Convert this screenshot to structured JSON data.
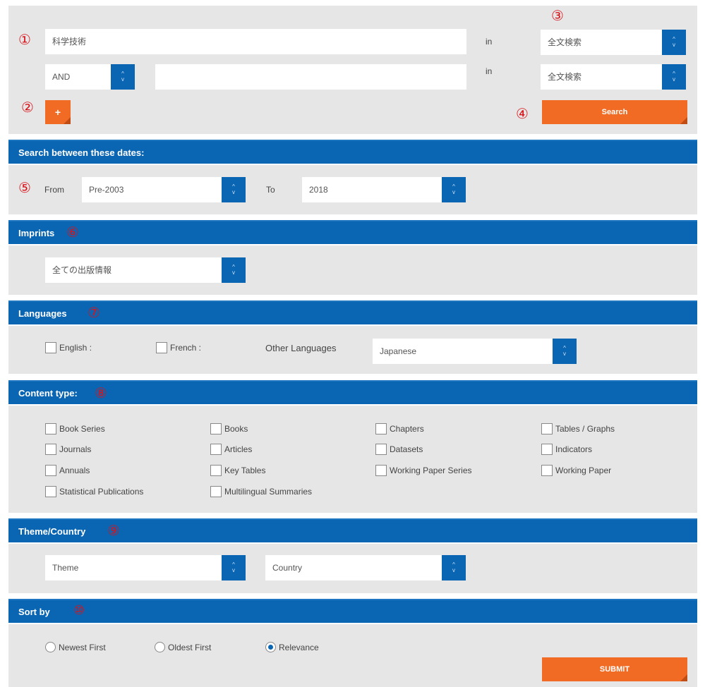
{
  "markers": [
    "①",
    "②",
    "③",
    "④",
    "⑤",
    "⑥",
    "⑦",
    "⑧",
    "⑨",
    "⑩"
  ],
  "search": {
    "query1": "科学技術",
    "in_label": "in",
    "scope1": "全文検索",
    "operator": "AND",
    "query2": "",
    "scope2": "全文検索",
    "add_label": "+",
    "search_label": "Search"
  },
  "dates": {
    "header": "Search between these dates:",
    "from_label": "From",
    "from_value": "Pre-2003",
    "to_label": "To",
    "to_value": "2018"
  },
  "imprints": {
    "header": "Imprints",
    "value": "全ての出版情報"
  },
  "languages": {
    "header": "Languages",
    "english": "English :",
    "french": "French :",
    "other_label": "Other Languages",
    "other_value": "Japanese"
  },
  "content_type": {
    "header": "Content type:",
    "items": [
      "Book Series",
      "Books",
      "Chapters",
      "Tables / Graphs",
      "Journals",
      "Articles",
      "Datasets",
      "Indicators",
      "Annuals",
      "Key Tables",
      "Working Paper Series",
      "Working Paper",
      "Statistical Publications",
      "Multilingual Summaries"
    ]
  },
  "theme_country": {
    "header": "Theme/Country",
    "theme": "Theme",
    "country": "Country"
  },
  "sort": {
    "header": "Sort by",
    "options": [
      "Newest First",
      "Oldest First",
      "Relevance"
    ],
    "selected": "Relevance",
    "submit_label": "SUBMIT"
  },
  "colors": {
    "bar_blue": "#0a65b3",
    "button_orange": "#f26b25",
    "panel_gray": "#e6e6e6",
    "marker_red": "#d8141b"
  }
}
